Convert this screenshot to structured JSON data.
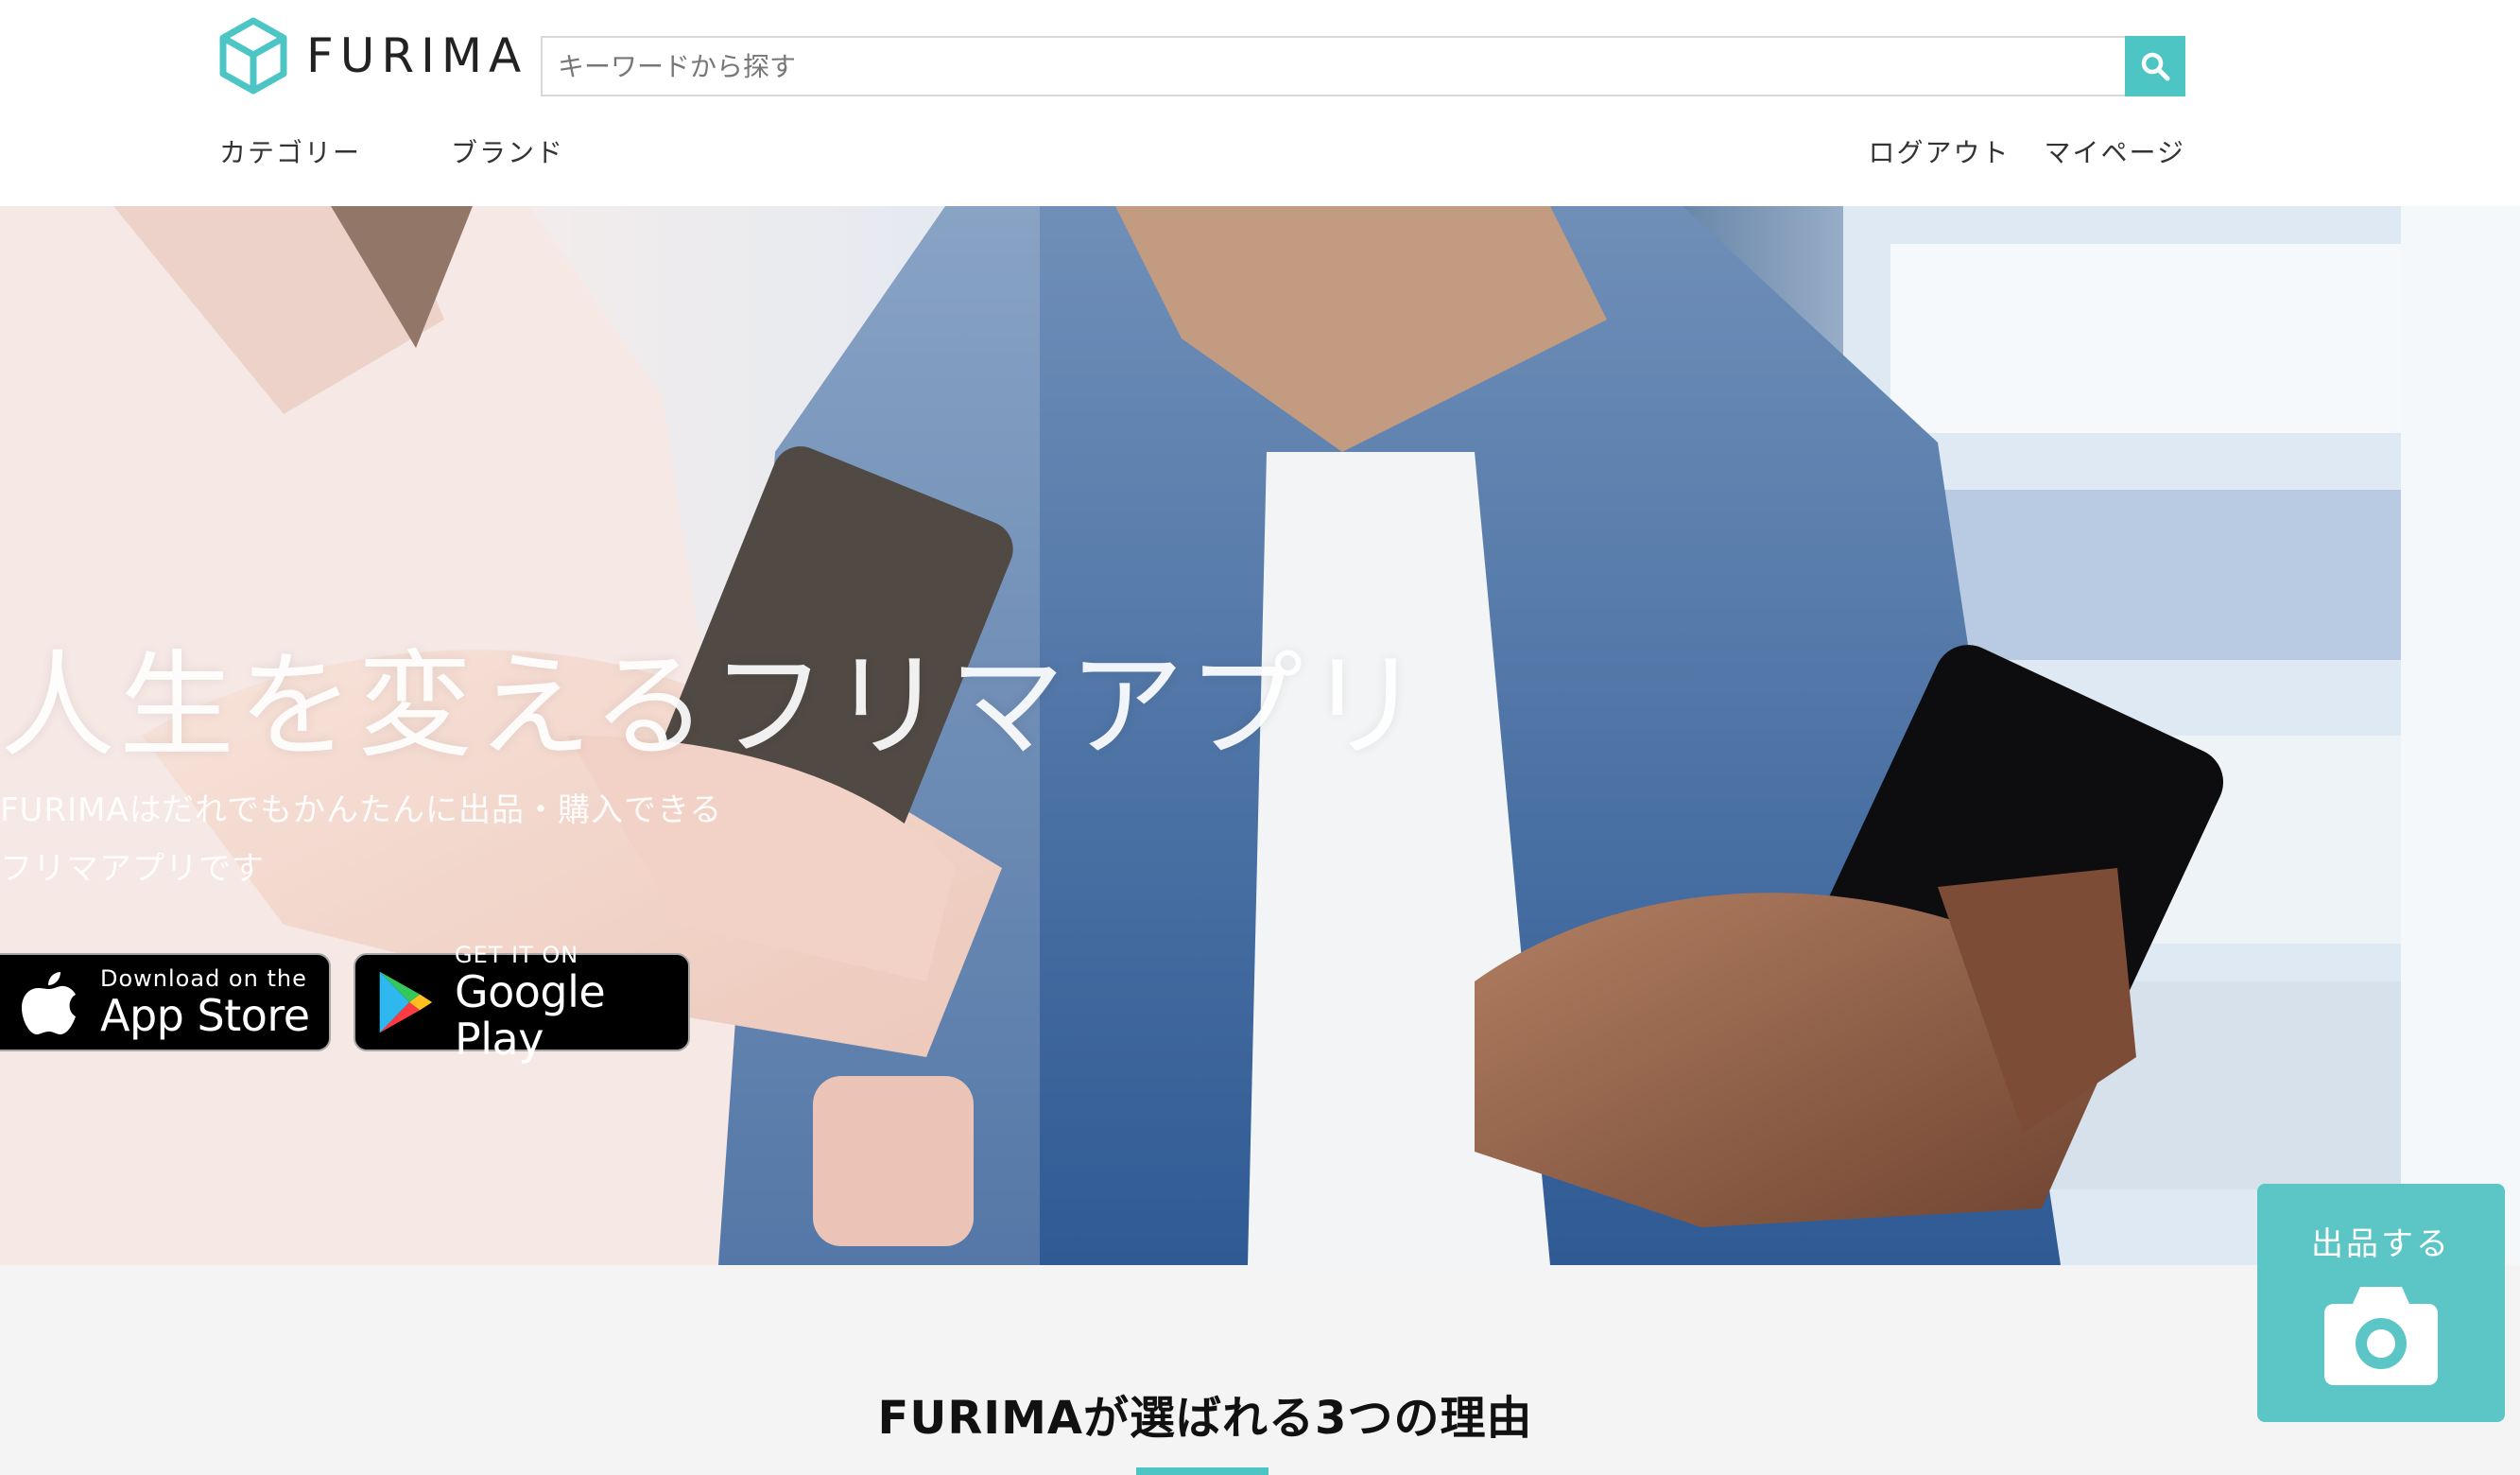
{
  "header": {
    "logo_text": "FURIMA",
    "search": {
      "placeholder": "キーワードから探す",
      "value": ""
    },
    "nav_left": [
      "カテゴリー",
      "ブランド"
    ],
    "nav_right": [
      "ログアウト",
      "マイページ"
    ]
  },
  "hero": {
    "title": "人生を変えるフリマアプリ",
    "subtitle_line1": "FURIMAはだれでもかんたんに出品・購入できる",
    "subtitle_line2": "フリマアプリです",
    "app_store": {
      "small": "Download on the",
      "big": "App Store"
    },
    "google_play": {
      "small": "GET IT ON",
      "big": "Google Play"
    }
  },
  "reasons": {
    "title": "FURIMAが選ばれる3つの理由"
  },
  "sell_button": {
    "label": "出品する"
  },
  "colors": {
    "accent": "#4ec5c5",
    "sell_bg": "#5cc6c6",
    "reasons_bg": "#f4f4f4"
  },
  "icons": [
    "cube-logo-icon",
    "search-icon",
    "apple-icon",
    "google-play-icon",
    "camera-icon"
  ]
}
